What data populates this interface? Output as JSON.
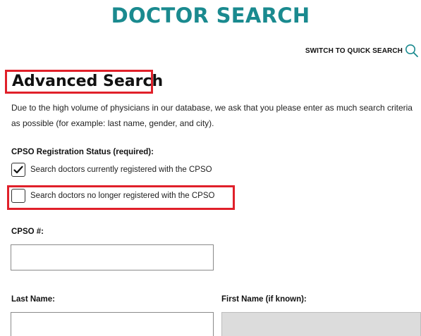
{
  "header": {
    "title": "DOCTOR SEARCH"
  },
  "quick_search": {
    "label": "SWITCH TO QUICK SEARCH",
    "icon": "search-icon",
    "icon_color": "#1a8a8f"
  },
  "advanced": {
    "heading": "Advanced Search",
    "intro": "Due to the high volume of physicians in our database, we ask that you please enter as much search criteria as possible (for example: last name, gender, and city)."
  },
  "registration": {
    "label": "CPSO Registration Status (required):",
    "options": [
      {
        "label": "Search doctors currently registered with the CPSO",
        "checked": true
      },
      {
        "label": "Search doctors no longer registered with the CPSO",
        "checked": false
      }
    ]
  },
  "fields": {
    "cpso_number": {
      "label": "CPSO #:",
      "value": "",
      "placeholder": ""
    },
    "last_name": {
      "label": "Last Name:",
      "value": "",
      "placeholder": ""
    },
    "first_name": {
      "label": "First Name (if known):",
      "value": "",
      "placeholder": ""
    }
  },
  "colors": {
    "brand": "#1a8a8f",
    "highlight": "#e0202a"
  }
}
